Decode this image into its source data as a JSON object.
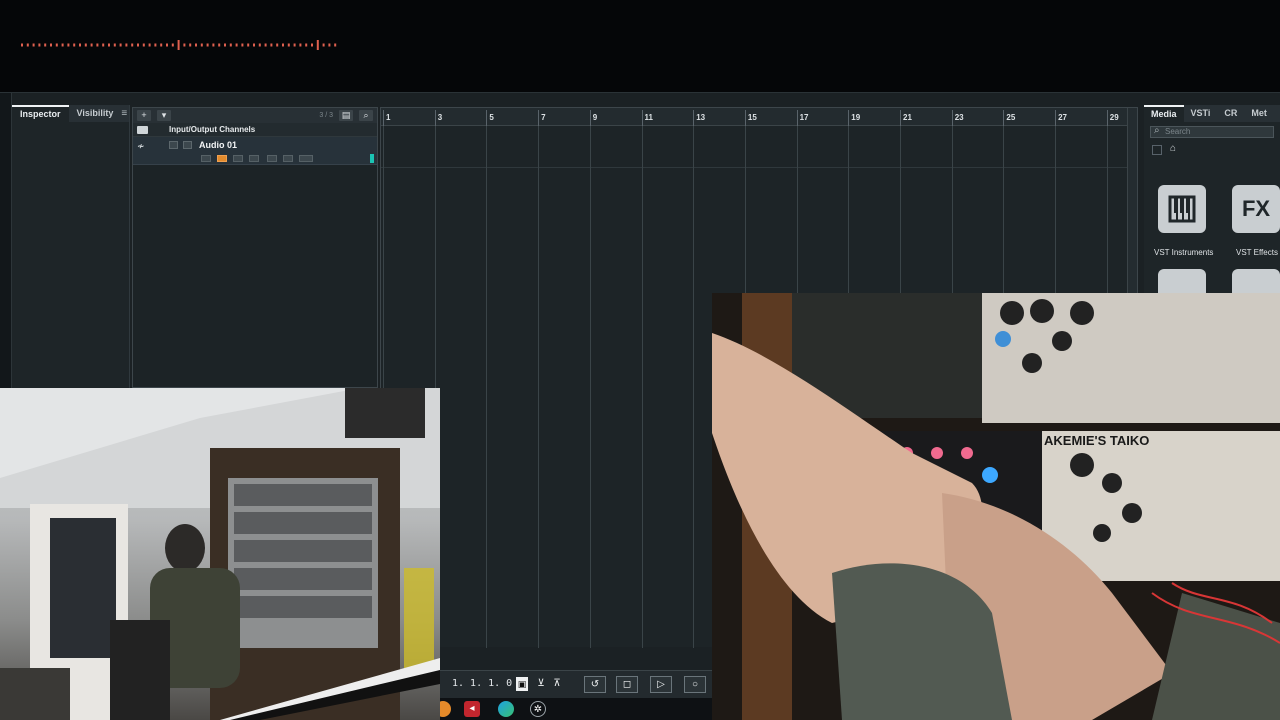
{
  "inspector": {
    "tabs": [
      "Inspector",
      "Visibility"
    ],
    "menu_icon": "hamburger-menu-icon"
  },
  "tracklist": {
    "count": "3 / 3",
    "add_label": "+",
    "dropdown_label": "▾",
    "folder_track": "Input/Output Channels",
    "audio_track": "Audio 01"
  },
  "ruler": {
    "bars": [
      "1",
      "3",
      "5",
      "7",
      "9",
      "11",
      "13",
      "15",
      "17",
      "19",
      "21",
      "23",
      "25",
      "27",
      "29"
    ]
  },
  "media": {
    "tabs": [
      "Media",
      "VSTi",
      "CR",
      "Met"
    ],
    "search_placeholder": "Search",
    "tiles": [
      {
        "label": "VST Instruments",
        "icon": "piano-keys-icon"
      },
      {
        "label": "VST Effects",
        "glyph": "FX",
        "icon": "fx-icon"
      }
    ]
  },
  "transport": {
    "position": "1. 1. 1.  0"
  },
  "webcam": {
    "module_label": "AKEMIE'S TAIKO"
  },
  "colors": {
    "accent_orange": "#e38b2c",
    "meter_teal": "#1bc4b3",
    "waveform_red": "#e0604f"
  }
}
